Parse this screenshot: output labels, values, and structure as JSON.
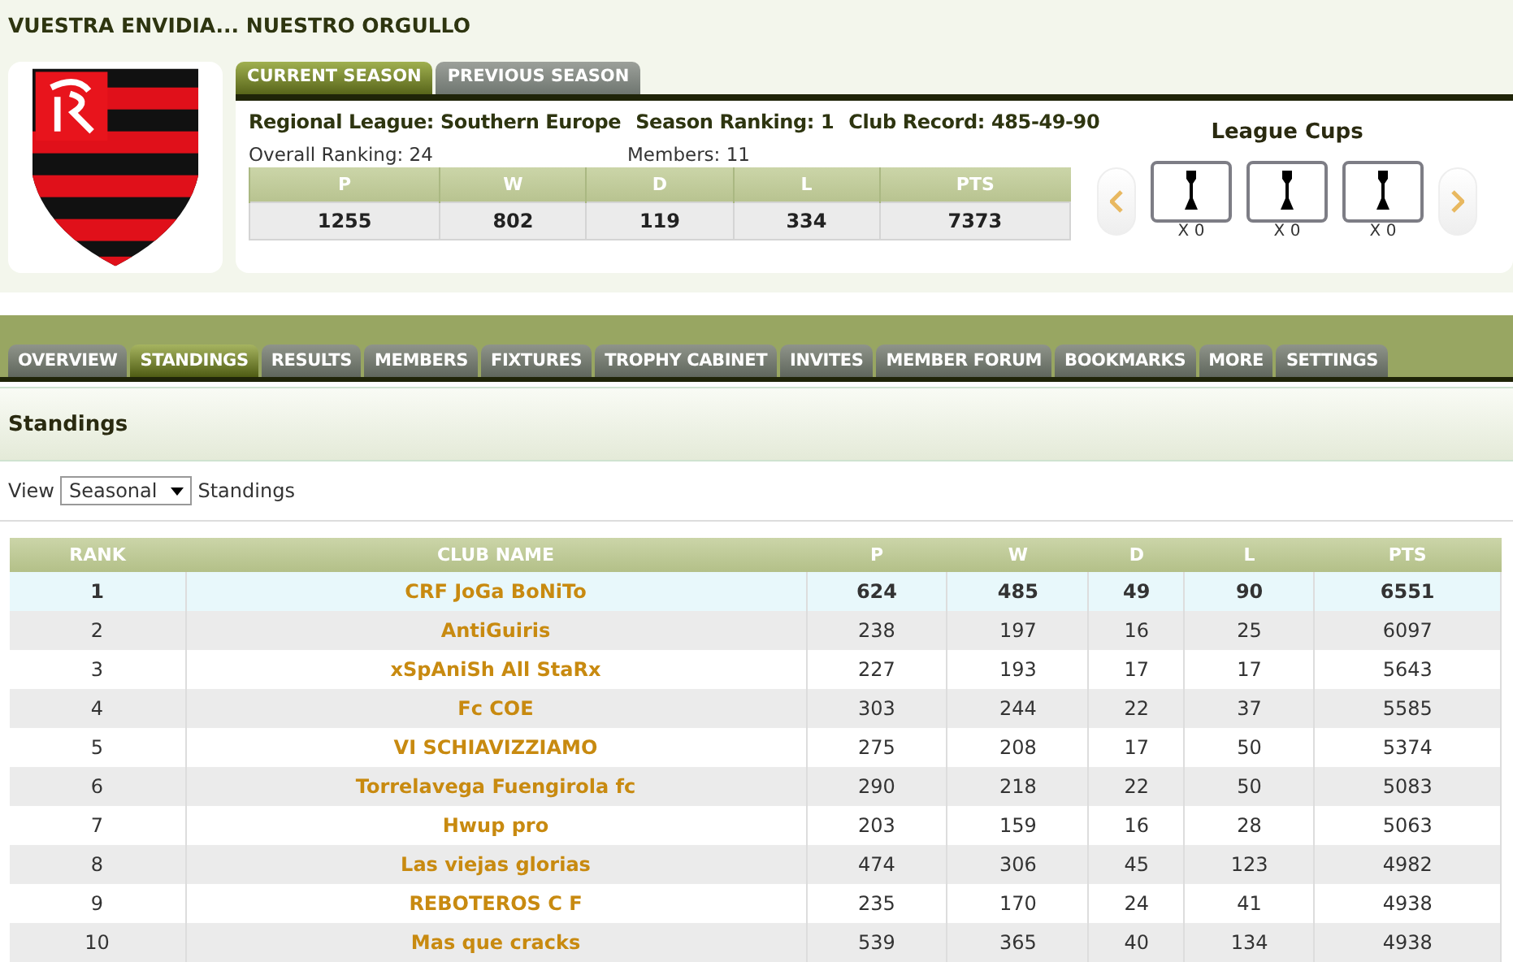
{
  "page_title": "VUESTRA ENVIDIA... NUESTRO ORGULLO",
  "season_tabs": [
    {
      "label": "CURRENT SEASON",
      "selected": true
    },
    {
      "label": "PREVIOUS SEASON",
      "selected": false
    }
  ],
  "club_info": {
    "regional_league": "Regional League: Southern Europe",
    "season_ranking": "Season Ranking: 1",
    "club_record": "Club Record: 485-49-90",
    "overall_ranking": "Overall Ranking: 24",
    "members": "Members: 11"
  },
  "summary": {
    "columns": [
      "P",
      "W",
      "D",
      "L",
      "PTS"
    ],
    "values": [
      "1255",
      "802",
      "119",
      "334",
      "7373"
    ]
  },
  "league_cups": {
    "title": "League Cups",
    "cups": [
      {
        "count": "X 0"
      },
      {
        "count": "X 0"
      },
      {
        "count": "X 0"
      }
    ]
  },
  "nav_tabs": [
    {
      "label": "OVERVIEW",
      "selected": false
    },
    {
      "label": "STANDINGS",
      "selected": true
    },
    {
      "label": "RESULTS",
      "selected": false
    },
    {
      "label": "MEMBERS",
      "selected": false
    },
    {
      "label": "FIXTURES",
      "selected": false
    },
    {
      "label": "TROPHY CABINET",
      "selected": false
    },
    {
      "label": "INVITES",
      "selected": false
    },
    {
      "label": "MEMBER FORUM",
      "selected": false
    },
    {
      "label": "BOOKMARKS",
      "selected": false
    },
    {
      "label": "MORE",
      "selected": false
    },
    {
      "label": "SETTINGS",
      "selected": false
    }
  ],
  "section_title": "Standings",
  "view_filter": {
    "prefix": "View",
    "value": "Seasonal",
    "suffix": "Standings"
  },
  "table": {
    "columns": [
      "RANK",
      "CLUB NAME",
      "P",
      "W",
      "D",
      "L",
      "PTS"
    ],
    "rows": [
      {
        "cells": [
          "1",
          "CRF JoGa BoNiTo",
          "624",
          "485",
          "49",
          "90",
          "6551"
        ],
        "selected": true
      },
      {
        "cells": [
          "2",
          "AntiGuiris",
          "238",
          "197",
          "16",
          "25",
          "6097"
        ],
        "selected": false
      },
      {
        "cells": [
          "3",
          "xSpAniSh All StaRx",
          "227",
          "193",
          "17",
          "17",
          "5643"
        ],
        "selected": false
      },
      {
        "cells": [
          "4",
          "Fc COE",
          "303",
          "244",
          "22",
          "37",
          "5585"
        ],
        "selected": false
      },
      {
        "cells": [
          "5",
          "VI SCHIAVIZZIAMO",
          "275",
          "208",
          "17",
          "50",
          "5374"
        ],
        "selected": false
      },
      {
        "cells": [
          "6",
          "Torrelavega Fuengirola fc",
          "290",
          "218",
          "22",
          "50",
          "5083"
        ],
        "selected": false
      },
      {
        "cells": [
          "7",
          "Hwup pro",
          "203",
          "159",
          "16",
          "28",
          "5063"
        ],
        "selected": false
      },
      {
        "cells": [
          "8",
          "Las viejas glorias",
          "474",
          "306",
          "45",
          "123",
          "4982"
        ],
        "selected": false
      },
      {
        "cells": [
          "9",
          "REBOTEROS C F",
          "235",
          "170",
          "24",
          "41",
          "4938"
        ],
        "selected": false
      },
      {
        "cells": [
          "10",
          "Mas que cracks",
          "539",
          "365",
          "40",
          "134",
          "4938"
        ],
        "selected": false
      }
    ]
  }
}
